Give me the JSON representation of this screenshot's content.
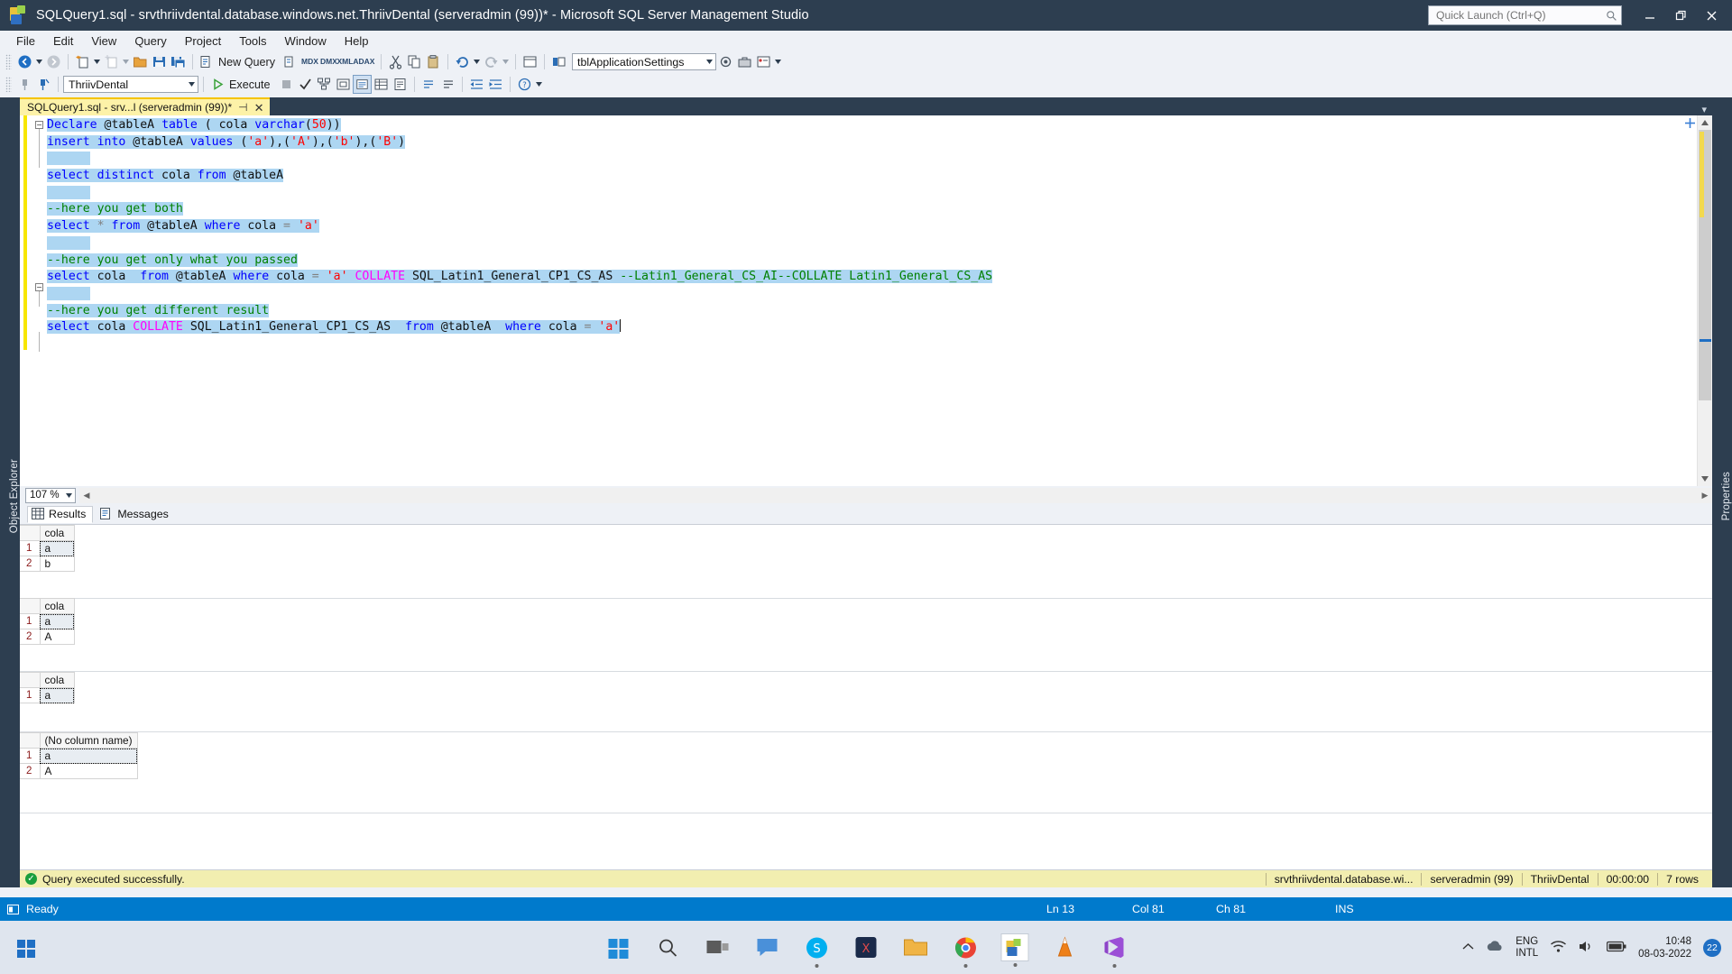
{
  "window": {
    "title": "SQLQuery1.sql - srvthriivdental.database.windows.net.ThriivDental (serveradmin (99))* - Microsoft SQL Server Management Studio",
    "app_icon": "ssms-icon",
    "minimize_label": "Minimize",
    "restore_label": "Restore Down",
    "close_label": "Close"
  },
  "quick_launch": {
    "placeholder": "Quick Launch (Ctrl+Q)",
    "value": "",
    "icon": "search-icon"
  },
  "menu": {
    "items": [
      {
        "label": "File"
      },
      {
        "label": "Edit"
      },
      {
        "label": "View"
      },
      {
        "label": "Query"
      },
      {
        "label": "Project"
      },
      {
        "label": "Tools"
      },
      {
        "label": "Window"
      },
      {
        "label": "Help"
      }
    ]
  },
  "toolbar_main": {
    "new_query_label": "New Query",
    "object_combo_value": "tblApplicationSettings",
    "mdx_label": "MDX",
    "dmx_label": "DMX",
    "xmla_label": "XMLA",
    "dax_label": "DAX"
  },
  "toolbar_query": {
    "database_value": "ThriivDental",
    "execute_label": "Execute",
    "execute_icon": "play-icon",
    "stop_icon": "stop-icon",
    "parse_icon": "checkmark-icon"
  },
  "document_tab": {
    "label": "SQLQuery1.sql - srv...l (serveradmin (99))*",
    "pin_icon": "pin-icon",
    "close_icon": "close-icon"
  },
  "panels": {
    "object_explorer": "Object Explorer",
    "properties": "Properties"
  },
  "editor": {
    "zoom_level": "107 %",
    "lines": [
      {
        "n": 1,
        "fold": true,
        "tokens": [
          {
            "t": "Declare ",
            "c": "kw"
          },
          {
            "t": "@tableA ",
            "c": "plain"
          },
          {
            "t": "table ",
            "c": "kw"
          },
          {
            "t": "( cola ",
            "c": "plain"
          },
          {
            "t": "varchar",
            "c": "kw"
          },
          {
            "t": "(",
            "c": "plain"
          },
          {
            "t": "50",
            "c": "str"
          },
          {
            "t": "))",
            "c": "plain"
          }
        ]
      },
      {
        "n": 2,
        "tokens": [
          {
            "t": "insert into ",
            "c": "kw"
          },
          {
            "t": "@tableA ",
            "c": "plain"
          },
          {
            "t": "values ",
            "c": "kw"
          },
          {
            "t": "(",
            "c": "plain"
          },
          {
            "t": "'a'",
            "c": "str"
          },
          {
            "t": "),(",
            "c": "plain"
          },
          {
            "t": "'A'",
            "c": "str"
          },
          {
            "t": "),(",
            "c": "plain"
          },
          {
            "t": "'b'",
            "c": "str"
          },
          {
            "t": "),(",
            "c": "plain"
          },
          {
            "t": "'B'",
            "c": "str"
          },
          {
            "t": ")",
            "c": "plain"
          }
        ]
      },
      {
        "n": 3,
        "tokens": [
          {
            "t": "",
            "c": "plain"
          }
        ]
      },
      {
        "n": 4,
        "tokens": [
          {
            "t": "select distinct ",
            "c": "kw"
          },
          {
            "t": "cola ",
            "c": "plain"
          },
          {
            "t": "from ",
            "c": "kw"
          },
          {
            "t": "@tableA",
            "c": "plain"
          }
        ]
      },
      {
        "n": 5,
        "tokens": [
          {
            "t": "",
            "c": "plain"
          }
        ]
      },
      {
        "n": 6,
        "tokens": [
          {
            "t": "--here you get both",
            "c": "cmt"
          }
        ]
      },
      {
        "n": 7,
        "tokens": [
          {
            "t": "select ",
            "c": "kw"
          },
          {
            "t": "* ",
            "c": "op"
          },
          {
            "t": "from ",
            "c": "kw"
          },
          {
            "t": "@tableA ",
            "c": "plain"
          },
          {
            "t": "where ",
            "c": "kw"
          },
          {
            "t": "cola ",
            "c": "plain"
          },
          {
            "t": "= ",
            "c": "op"
          },
          {
            "t": "'a'",
            "c": "str"
          }
        ]
      },
      {
        "n": 8,
        "tokens": [
          {
            "t": "",
            "c": "plain"
          }
        ]
      },
      {
        "n": 9,
        "tokens": [
          {
            "t": "--here you get only what you passed",
            "c": "cmt"
          }
        ]
      },
      {
        "n": 10,
        "fold": true,
        "tokens": [
          {
            "t": "select ",
            "c": "kw"
          },
          {
            "t": "cola  ",
            "c": "plain"
          },
          {
            "t": "from ",
            "c": "kw"
          },
          {
            "t": "@tableA ",
            "c": "plain"
          },
          {
            "t": "where ",
            "c": "kw"
          },
          {
            "t": "cola ",
            "c": "plain"
          },
          {
            "t": "= ",
            "c": "op"
          },
          {
            "t": "'a' ",
            "c": "str"
          },
          {
            "t": "COLLATE ",
            "c": "fn"
          },
          {
            "t": "SQL_Latin1_General_CP1_CS_AS ",
            "c": "plain"
          },
          {
            "t": "--Latin1_General_CS_AI--COLLATE Latin1_General_CS_AS",
            "c": "cmt"
          }
        ]
      },
      {
        "n": 11,
        "tokens": [
          {
            "t": "",
            "c": "plain"
          }
        ]
      },
      {
        "n": 12,
        "tokens": [
          {
            "t": "--here you get different result",
            "c": "cmt"
          }
        ]
      },
      {
        "n": 13,
        "caret": true,
        "tokens": [
          {
            "t": "select ",
            "c": "kw"
          },
          {
            "t": "cola ",
            "c": "plain"
          },
          {
            "t": "COLLATE ",
            "c": "fn"
          },
          {
            "t": "SQL_Latin1_General_CP1_CS_AS  ",
            "c": "plain"
          },
          {
            "t": "from ",
            "c": "kw"
          },
          {
            "t": "@tableA  ",
            "c": "plain"
          },
          {
            "t": "where ",
            "c": "kw"
          },
          {
            "t": "cola ",
            "c": "plain"
          },
          {
            "t": "= ",
            "c": "op"
          },
          {
            "t": "'a'",
            "c": "str"
          }
        ]
      }
    ]
  },
  "results": {
    "tabs": [
      {
        "label": "Results",
        "icon": "grid-icon",
        "active": true
      },
      {
        "label": "Messages",
        "icon": "message-icon",
        "active": false
      }
    ],
    "grids": [
      {
        "columns": [
          "cola"
        ],
        "rows": [
          {
            "n": "1",
            "values": [
              "a"
            ],
            "selected": true
          },
          {
            "n": "2",
            "values": [
              "b"
            ]
          }
        ]
      },
      {
        "columns": [
          "cola"
        ],
        "rows": [
          {
            "n": "1",
            "values": [
              "a"
            ],
            "selected": true
          },
          {
            "n": "2",
            "values": [
              "A"
            ]
          }
        ]
      },
      {
        "columns": [
          "cola"
        ],
        "rows": [
          {
            "n": "1",
            "values": [
              "a"
            ],
            "selected": true
          }
        ]
      },
      {
        "columns": [
          "(No column name)"
        ],
        "rows": [
          {
            "n": "1",
            "values": [
              "a"
            ],
            "selected": true
          },
          {
            "n": "2",
            "values": [
              "A"
            ]
          }
        ]
      }
    ],
    "status": {
      "icon": "success-icon",
      "message": "Query executed successfully.",
      "server": "srvthriivdental.database.wi...",
      "user": "serveradmin (99)",
      "database": "ThriivDental",
      "elapsed": "00:00:00",
      "rows": "7 rows"
    }
  },
  "ide_status": {
    "icon": "ready-icon",
    "ready": "Ready",
    "line": "Ln 13",
    "col": "Col 81",
    "ch": "Ch 81",
    "mode": "INS"
  },
  "taskbar": {
    "start_icon": "windows-start-icon",
    "apps": [
      {
        "name": "windows-start-icon"
      },
      {
        "name": "search-icon"
      },
      {
        "name": "task-view-icon"
      },
      {
        "name": "chat-icon"
      },
      {
        "name": "skype-icon",
        "running": true
      },
      {
        "name": "xsplit-icon"
      },
      {
        "name": "file-explorer-icon"
      },
      {
        "name": "chrome-icon",
        "running": true
      },
      {
        "name": "ssms-icon",
        "running": true
      },
      {
        "name": "vlc-icon"
      },
      {
        "name": "visual-studio-icon",
        "running": true
      }
    ],
    "tray": {
      "chevron": "show-hidden-icons",
      "cloud": "onedrive-icon",
      "lang_line1": "ENG",
      "lang_line2": "INTL",
      "wifi": "wifi-icon",
      "volume": "volume-icon",
      "battery": "battery-icon",
      "time": "10:48",
      "date": "08-03-2022",
      "notifications": "22"
    }
  },
  "colors": {
    "titlebar": "#2d3e50",
    "accent": "#007acc",
    "tab_active": "#fdf2a8",
    "selection": "#add6f2",
    "keyword": "#0000ff",
    "string": "#ff0000",
    "comment": "#008000",
    "function": "#ff00ff",
    "status_yellow": "#f2eeb0"
  }
}
